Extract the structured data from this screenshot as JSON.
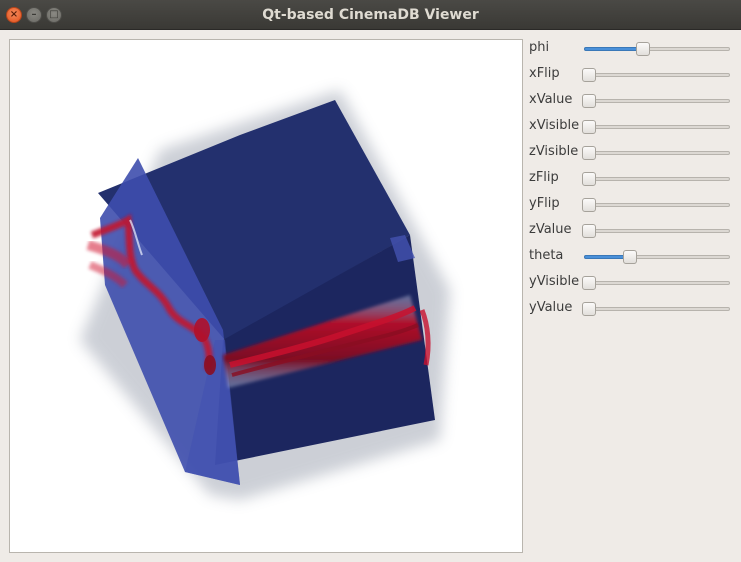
{
  "window": {
    "title": "Qt-based CinemaDB Viewer",
    "close_glyph": "×",
    "minimize_glyph": "–",
    "maximize_glyph": "□"
  },
  "sliders": [
    {
      "label": "phi",
      "level": 0.4
    },
    {
      "label": "xFlip",
      "level": 0.0
    },
    {
      "label": "xValue",
      "level": 0.0
    },
    {
      "label": "xVisible",
      "level": 0.0
    },
    {
      "label": "zVisible",
      "level": 0.0
    },
    {
      "label": "zFlip",
      "level": 0.0
    },
    {
      "label": "yFlip",
      "level": 0.0
    },
    {
      "label": "zValue",
      "level": 0.0
    },
    {
      "label": "theta",
      "level": 0.3
    },
    {
      "label": "yVisible",
      "level": 0.0
    },
    {
      "label": "yValue",
      "level": 0.0
    }
  ],
  "colors": {
    "accent": "#4a90d9",
    "slab_dark": "#1f2a66",
    "slab_light": "#4352b0",
    "plume": "#c2122e"
  },
  "icons": [
    "close-icon",
    "minimize-icon",
    "maximize-icon"
  ]
}
